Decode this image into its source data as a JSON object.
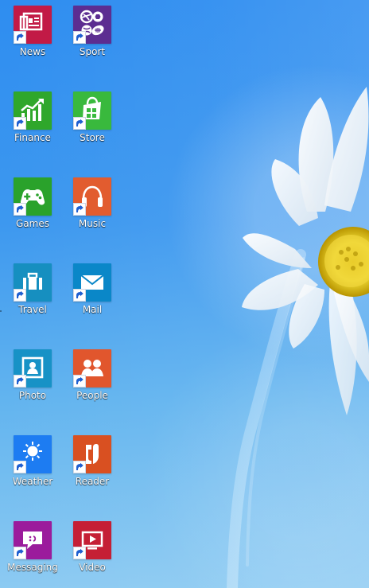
{
  "desktop": {
    "icons": [
      {
        "label": "News",
        "icon": "news-icon",
        "color": "#c21a46"
      },
      {
        "label": "Sport",
        "icon": "sports-icon",
        "color": "#5c2d91"
      },
      {
        "label": "Finance",
        "icon": "finance-icon",
        "color": "#2fa72b"
      },
      {
        "label": "Store",
        "icon": "store-icon",
        "color": "#39b93d"
      },
      {
        "label": "Games",
        "icon": "gamepad-icon",
        "color": "#2aa22b"
      },
      {
        "label": "Music",
        "icon": "headphones-icon",
        "color": "#e25c2f"
      },
      {
        "label": "Travel",
        "icon": "suitcase-icon",
        "color": "#168fc0"
      },
      {
        "label": "Mail",
        "icon": "mail-icon",
        "color": "#0a87c8"
      },
      {
        "label": "Photo",
        "icon": "photo-icon",
        "color": "#1792c6"
      },
      {
        "label": "People",
        "icon": "people-icon",
        "color": "#e1562d"
      },
      {
        "label": "Weather",
        "icon": "weather-icon",
        "color": "#1d7cf2"
      },
      {
        "label": "Reader",
        "icon": "reader-icon",
        "color": "#d95021"
      },
      {
        "label": "Messaging",
        "icon": "messaging-icon",
        "color": "#9b1b9c"
      },
      {
        "label": "Video",
        "icon": "video-icon",
        "color": "#c51f35"
      }
    ]
  }
}
